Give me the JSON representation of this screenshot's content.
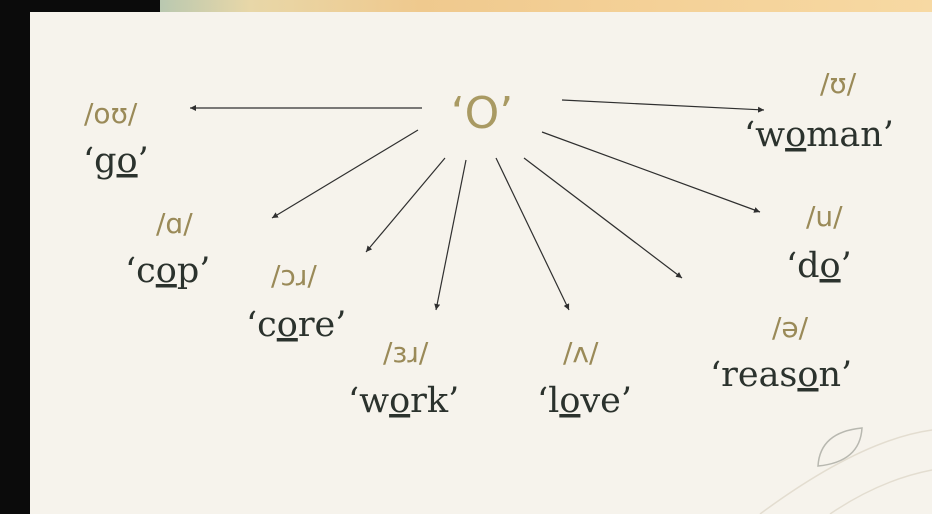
{
  "center_letter": "‘O’",
  "sounds": [
    {
      "id": "go",
      "ipa": "/oʊ/",
      "word_pre": "‘g",
      "word_u": "o",
      "word_post": "’"
    },
    {
      "id": "cop",
      "ipa": "/ɑ/",
      "word_pre": "‘c",
      "word_u": "o",
      "word_post": "p’"
    },
    {
      "id": "core",
      "ipa": "/ɔɹ/",
      "word_pre": "‘c",
      "word_u": "o",
      "word_post": "re’"
    },
    {
      "id": "work",
      "ipa": "/ɜɹ/",
      "word_pre": "‘w",
      "word_u": "o",
      "word_post": "rk’"
    },
    {
      "id": "love",
      "ipa": "/ʌ/",
      "word_pre": "‘l",
      "word_u": "o",
      "word_post": "ve’"
    },
    {
      "id": "reason",
      "ipa": "/ə/",
      "word_pre": "‘reas",
      "word_u": "o",
      "word_post": "n’"
    },
    {
      "id": "do",
      "ipa": "/u/",
      "word_pre": "‘d",
      "word_u": "o",
      "word_post": "’"
    },
    {
      "id": "woman",
      "ipa": "/ʊ/",
      "word_pre": "‘w",
      "word_u": "o",
      "word_post": "man’"
    }
  ]
}
